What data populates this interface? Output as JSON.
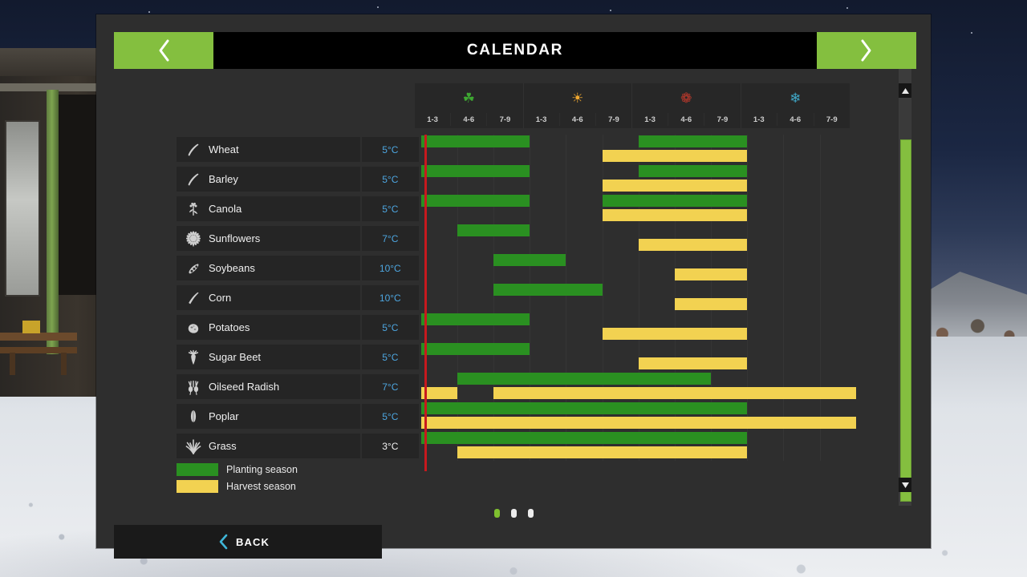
{
  "header": {
    "title": "CALENDAR",
    "prev_icon": "chevron-left-icon",
    "next_icon": "chevron-right-icon"
  },
  "accent_colors": {
    "menu_green": "#84bf3f",
    "planting_green": "#2a9021",
    "harvest_yellow": "#f2d251",
    "today_red": "#c8191e",
    "temp_blue": "#4da6e0",
    "panel_bg": "#2e2e2e",
    "row_bg": "#252525"
  },
  "timeline": {
    "months": 12,
    "today_month": 0,
    "seasons": [
      {
        "name": "Spring",
        "icon": "spring-sprout-icon",
        "icon_glyph": "☘",
        "icon_color": "#3ea832",
        "days": [
          "1-3",
          "4-6",
          "7-9"
        ]
      },
      {
        "name": "Summer",
        "icon": "summer-sun-icon",
        "icon_glyph": "☀",
        "icon_color": "#f0a830",
        "days": [
          "1-3",
          "4-6",
          "7-9"
        ]
      },
      {
        "name": "Autumn",
        "icon": "autumn-leaf-icon",
        "icon_glyph": "❁",
        "icon_color": "#c0392b",
        "days": [
          "1-3",
          "4-6",
          "7-9"
        ]
      },
      {
        "name": "Winter",
        "icon": "winter-snowflake-icon",
        "icon_glyph": "❄",
        "icon_color": "#3fa8c8",
        "days": [
          "1-3",
          "4-6",
          "7-9"
        ]
      }
    ]
  },
  "crops": [
    {
      "name": "Wheat",
      "icon": "wheat-icon",
      "temp": "5°C",
      "temp_warm": false,
      "planting": [
        [
          0,
          3
        ],
        [
          6,
          9
        ]
      ],
      "harvest": [
        [
          5,
          9
        ]
      ]
    },
    {
      "name": "Barley",
      "icon": "barley-icon",
      "temp": "5°C",
      "temp_warm": false,
      "planting": [
        [
          0,
          3
        ],
        [
          6,
          9
        ]
      ],
      "harvest": [
        [
          5,
          9
        ]
      ]
    },
    {
      "name": "Canola",
      "icon": "canola-icon",
      "temp": "5°C",
      "temp_warm": false,
      "planting": [
        [
          0,
          3
        ],
        [
          5,
          9
        ]
      ],
      "harvest": [
        [
          5,
          9
        ]
      ]
    },
    {
      "name": "Sunflowers",
      "icon": "sunflower-icon",
      "temp": "7°C",
      "temp_warm": false,
      "planting": [
        [
          1,
          3
        ]
      ],
      "harvest": [
        [
          6,
          9
        ]
      ]
    },
    {
      "name": "Soybeans",
      "icon": "soybean-icon",
      "temp": "10°C",
      "temp_warm": false,
      "planting": [
        [
          2,
          4
        ]
      ],
      "harvest": [
        [
          7,
          9
        ]
      ]
    },
    {
      "name": "Corn",
      "icon": "corn-icon",
      "temp": "10°C",
      "temp_warm": false,
      "planting": [
        [
          2,
          5
        ]
      ],
      "harvest": [
        [
          7,
          9
        ]
      ]
    },
    {
      "name": "Potatoes",
      "icon": "potato-icon",
      "temp": "5°C",
      "temp_warm": false,
      "planting": [
        [
          0,
          3
        ]
      ],
      "harvest": [
        [
          5,
          9
        ]
      ]
    },
    {
      "name": "Sugar Beet",
      "icon": "sugar-beet-icon",
      "temp": "5°C",
      "temp_warm": false,
      "planting": [
        [
          0,
          3
        ]
      ],
      "harvest": [
        [
          6,
          9
        ]
      ]
    },
    {
      "name": "Oilseed Radish",
      "icon": "oilseed-radish-icon",
      "temp": "7°C",
      "temp_warm": false,
      "planting": [
        [
          1,
          8
        ]
      ],
      "harvest": [
        [
          0,
          1
        ],
        [
          2,
          12
        ]
      ]
    },
    {
      "name": "Poplar",
      "icon": "poplar-icon",
      "temp": "5°C",
      "temp_warm": false,
      "planting": [
        [
          0,
          9
        ]
      ],
      "harvest": [
        [
          0,
          12
        ]
      ]
    },
    {
      "name": "Grass",
      "icon": "grass-icon",
      "temp": "3°C",
      "temp_warm": true,
      "planting": [
        [
          0,
          9
        ]
      ],
      "harvest": [
        [
          1,
          9
        ]
      ]
    }
  ],
  "legend": [
    {
      "label": "Planting season",
      "swatch": "plant"
    },
    {
      "label": "Harvest season",
      "swatch": "harvest"
    }
  ],
  "scrollbar": {
    "up_icon": "triangle-up-icon",
    "down_icon": "triangle-down-icon"
  },
  "pagination": {
    "count": 3,
    "active_index": 0
  },
  "footer": {
    "back_label": "BACK",
    "back_icon": "chevron-left-icon"
  }
}
